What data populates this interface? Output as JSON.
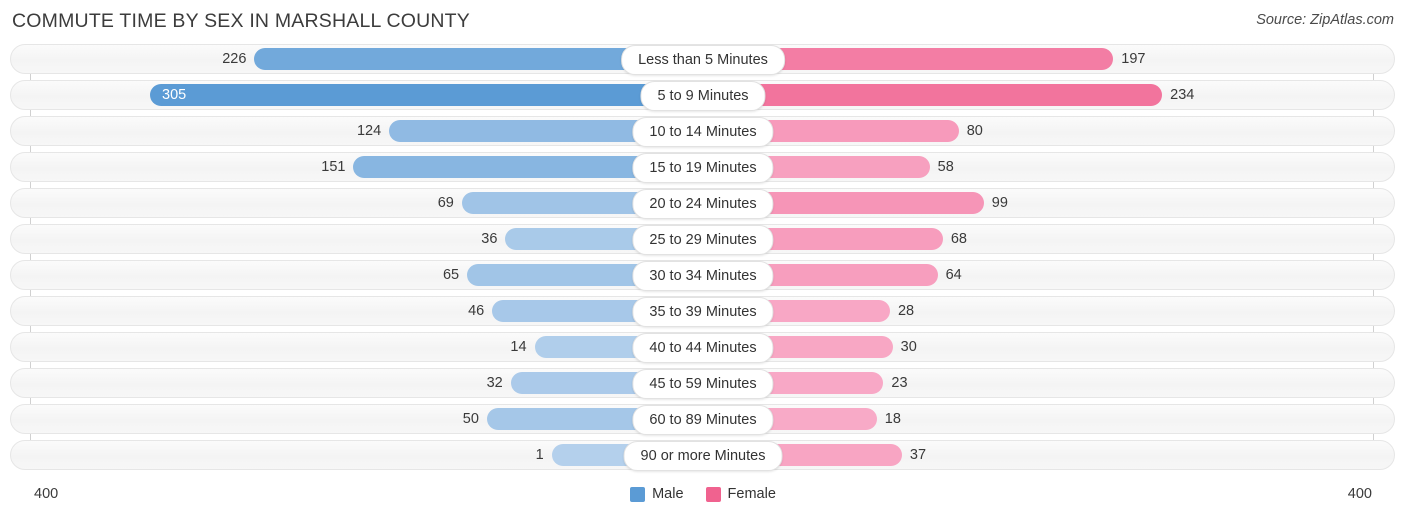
{
  "header": {
    "title": "COMMUTE TIME BY SEX IN MARSHALL COUNTY",
    "source": "Source: ZipAtlas.com"
  },
  "axis": {
    "min_label": "400",
    "max_label": "400"
  },
  "legend": {
    "items": [
      {
        "label": "Male",
        "color": "#5B9BD5"
      },
      {
        "label": "Female",
        "color": "#F0628F"
      }
    ]
  },
  "chart_data": {
    "type": "bar",
    "title": "COMMUTE TIME BY SEX IN MARSHALL COUNTY",
    "orientation": "horizontal-diverging",
    "xlabel": "",
    "ylabel": "",
    "xlim": [
      400,
      400
    ],
    "grid": false,
    "legend_position": "bottom-center",
    "categories": [
      "Less than 5 Minutes",
      "5 to 9 Minutes",
      "10 to 14 Minutes",
      "15 to 19 Minutes",
      "20 to 24 Minutes",
      "25 to 29 Minutes",
      "30 to 34 Minutes",
      "35 to 39 Minutes",
      "40 to 44 Minutes",
      "45 to 59 Minutes",
      "60 to 89 Minutes",
      "90 or more Minutes"
    ],
    "series": [
      {
        "name": "Male",
        "side": "left",
        "color": "#5B9BD5",
        "values": [
          226,
          305,
          124,
          151,
          69,
          36,
          65,
          46,
          14,
          32,
          50,
          1
        ]
      },
      {
        "name": "Female",
        "side": "right",
        "color": "#F0628F",
        "values": [
          197,
          234,
          80,
          58,
          99,
          68,
          64,
          28,
          30,
          23,
          18,
          37
        ]
      }
    ]
  }
}
